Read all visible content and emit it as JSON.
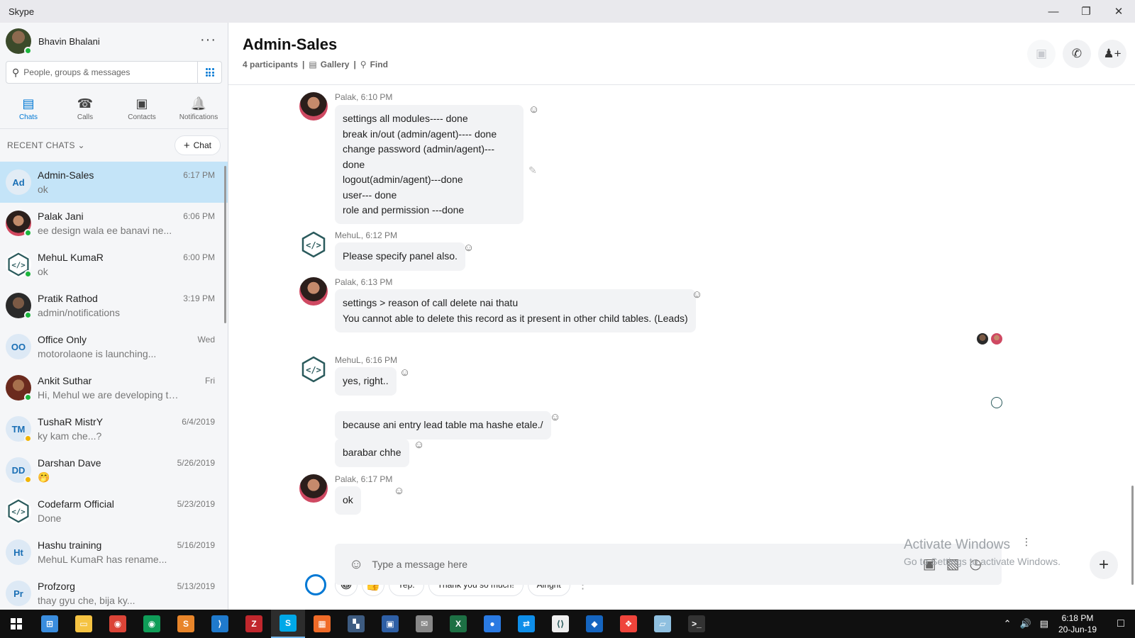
{
  "window": {
    "title": "Skype"
  },
  "profile": {
    "name": "Bhavin Bhalani"
  },
  "search": {
    "placeholder": "People, groups & messages"
  },
  "nav_tabs": [
    {
      "label": "Chats",
      "icon": "chat-icon",
      "active": true
    },
    {
      "label": "Calls",
      "icon": "phone-icon",
      "active": false
    },
    {
      "label": "Contacts",
      "icon": "contacts-icon",
      "active": false
    },
    {
      "label": "Notifications",
      "icon": "bell-icon",
      "active": false
    }
  ],
  "recent": {
    "header": "RECENT CHATS",
    "new_chat_label": "Chat"
  },
  "chats": [
    {
      "initials": "Ad",
      "name": "Admin-Sales",
      "snippet": "ok",
      "time": "6:17 PM",
      "avatar": "initials",
      "selected": true,
      "presence": ""
    },
    {
      "initials": "",
      "name": "Palak Jani",
      "snippet": "ee design wala ee banavi ne...",
      "time": "6:06 PM",
      "avatar": "photo-f",
      "selected": false,
      "presence": "online"
    },
    {
      "initials": "",
      "name": "MehuL KumaR",
      "snippet": "ok",
      "time": "6:00 PM",
      "avatar": "code",
      "selected": false,
      "presence": "online"
    },
    {
      "initials": "",
      "name": "Pratik Rathod",
      "snippet": "admin/notifications",
      "time": "3:19 PM",
      "avatar": "photo-m1",
      "selected": false,
      "presence": "online"
    },
    {
      "initials": "OO",
      "name": "Office Only",
      "snippet": "motorolaone is launching...",
      "time": "Wed",
      "avatar": "initials",
      "selected": false,
      "presence": ""
    },
    {
      "initials": "",
      "name": "Ankit Suthar",
      "snippet": "Hi, Mehul we are developing this...",
      "time": "Fri",
      "avatar": "photo-m2",
      "selected": false,
      "presence": "online"
    },
    {
      "initials": "TM",
      "name": "TushaR MistrY",
      "snippet": "ky kam che...?",
      "time": "6/4/2019",
      "avatar": "initials",
      "selected": false,
      "presence": "away"
    },
    {
      "initials": "DD",
      "name": "Darshan Dave",
      "snippet": "🤭",
      "time": "5/26/2019",
      "avatar": "initials",
      "selected": false,
      "presence": "away"
    },
    {
      "initials": "",
      "name": "Codefarm Official",
      "snippet": "Done",
      "time": "5/23/2019",
      "avatar": "code",
      "selected": false,
      "presence": ""
    },
    {
      "initials": "Ht",
      "name": "Hashu training",
      "snippet": "MehuL KumaR has rename...",
      "time": "5/16/2019",
      "avatar": "initials",
      "selected": false,
      "presence": ""
    },
    {
      "initials": "Pr",
      "name": "Profzorg",
      "snippet": "thay gyu che, bija ky...",
      "time": "5/13/2019",
      "avatar": "initials",
      "selected": false,
      "presence": ""
    }
  ],
  "conversation": {
    "title": "Admin-Sales",
    "participants": "4 participants",
    "gallery_label": "Gallery",
    "find_label": "Find"
  },
  "messages": [
    {
      "meta": "Palak, 6:10 PM",
      "lines": [
        "settings all modules---- done",
        "break in/out (admin/agent)---- done",
        "change password (admin/agent)---done",
        "logout(admin/agent)---done",
        "user--- done",
        "role and permission ---done"
      ]
    },
    {
      "meta": "MehuL, 6:12 PM",
      "lines": [
        "Please specify panel also."
      ]
    },
    {
      "meta": "Palak, 6:13 PM",
      "lines": [
        "settings > reason of call delete nai thatu",
        "You cannot able to delete this record as it present in other child tables. (Leads)"
      ]
    },
    {
      "meta": "MehuL, 6:16 PM",
      "lines": [
        "yes, right.."
      ]
    },
    {
      "meta": "",
      "lines": [
        "because ani entry lead table ma hashe etale./"
      ]
    },
    {
      "meta": "",
      "lines": [
        "barabar chhe"
      ]
    },
    {
      "meta": "Palak, 6:17 PM",
      "lines": [
        "ok"
      ]
    }
  ],
  "suggestions": {
    "emoji1": "😀",
    "emoji2": "👍",
    "replies": [
      "Yep.",
      "Thank you so much!",
      "Alright"
    ]
  },
  "composer": {
    "placeholder": "Type a message here"
  },
  "watermark": {
    "line1": "Activate Windows",
    "line2": "Go to Settings to activate Windows."
  },
  "taskbar": {
    "apps": [
      {
        "name": "store",
        "color": "#3a8dde",
        "glyph": "⊞"
      },
      {
        "name": "file-explorer",
        "color": "#f5c342",
        "glyph": "▭"
      },
      {
        "name": "chrome",
        "color": "#db4437",
        "glyph": "◉"
      },
      {
        "name": "chrome-2",
        "color": "#0f9d58",
        "glyph": "◉"
      },
      {
        "name": "sublime",
        "color": "#e8852a",
        "glyph": "S"
      },
      {
        "name": "vscode",
        "color": "#1f7acc",
        "glyph": "⟩"
      },
      {
        "name": "filezilla",
        "color": "#c1272d",
        "glyph": "Z"
      },
      {
        "name": "skype",
        "color": "#00a8e8",
        "glyph": "S"
      },
      {
        "name": "box",
        "color": "#f06b28",
        "glyph": "▦"
      },
      {
        "name": "editor",
        "color": "#3d5b80",
        "glyph": "▚"
      },
      {
        "name": "network",
        "color": "#2e5fa5",
        "glyph": "▣"
      },
      {
        "name": "mail",
        "color": "#888888",
        "glyph": "✉"
      },
      {
        "name": "excel",
        "color": "#1d7044",
        "glyph": "X"
      },
      {
        "name": "firefox",
        "color": "#2a7ae2",
        "glyph": "●"
      },
      {
        "name": "teamviewer",
        "color": "#0e8ee9",
        "glyph": "⇄"
      },
      {
        "name": "code-app",
        "color": "#eeeeee",
        "glyph": "⟨⟩"
      },
      {
        "name": "maps",
        "color": "#1565c0",
        "glyph": "◆"
      },
      {
        "name": "anydesk",
        "color": "#ef443b",
        "glyph": "❖"
      },
      {
        "name": "notepad",
        "color": "#8fc0e0",
        "glyph": "▱"
      },
      {
        "name": "terminal",
        "color": "#333333",
        "glyph": ">_"
      }
    ],
    "time": "6:18 PM",
    "date": "20-Jun-19"
  }
}
